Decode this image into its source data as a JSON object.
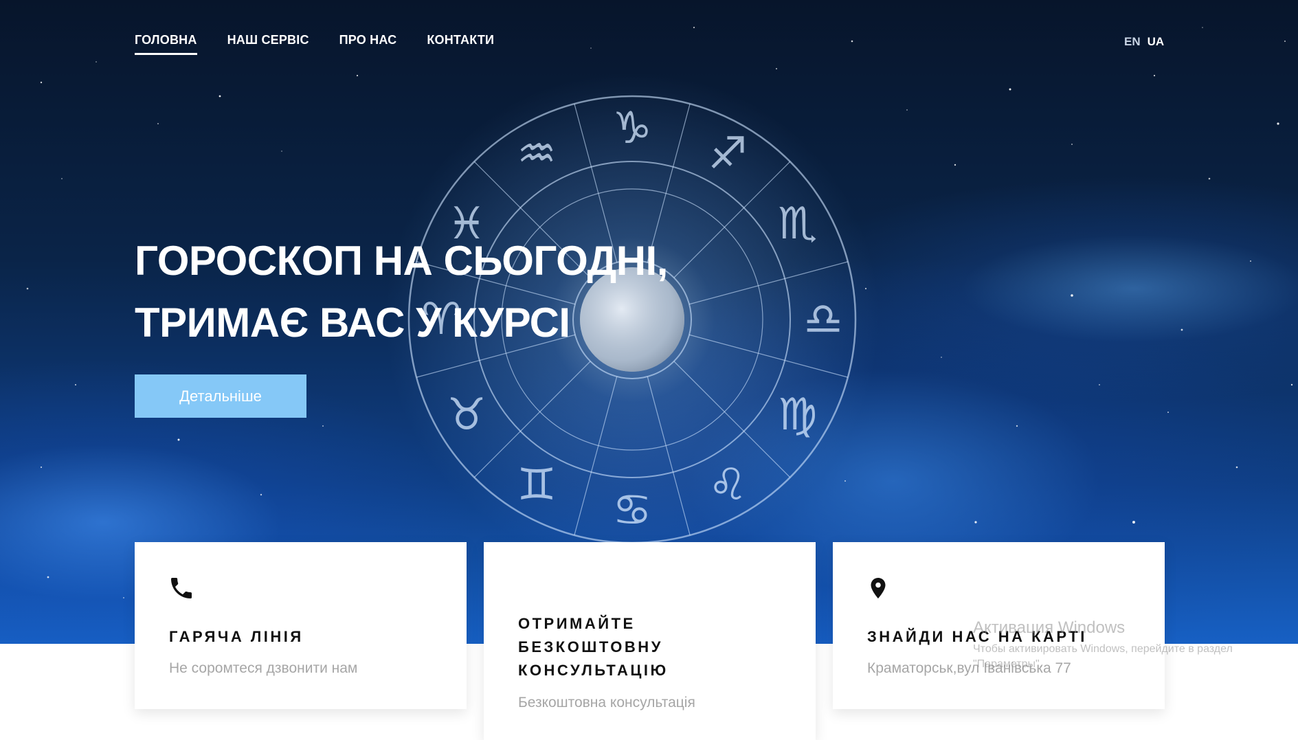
{
  "nav": {
    "items": [
      {
        "label": "ГОЛОВНА",
        "active": true
      },
      {
        "label": "НАШ СЕРВІС",
        "active": false
      },
      {
        "label": "ПРО НАС",
        "active": false
      },
      {
        "label": "КОНТАКТИ",
        "active": false
      }
    ]
  },
  "lang": {
    "en": "EN",
    "ua": "UA",
    "selected": "UA"
  },
  "hero": {
    "title_line1": "ГОРОСКОП НА СЬОГОДНІ,",
    "title_line2": "ТРИМАЄ ВАС У КУРСІ",
    "cta_label": "Детальніше",
    "background_image": "zodiac-wheel-with-full-moon-on-starry-sky",
    "zodiac_symbols": [
      "♑",
      "♐",
      "♏",
      "♎",
      "♍",
      "♌",
      "♋",
      "♊",
      "♉",
      "♈",
      "♓",
      "♒"
    ]
  },
  "cards": [
    {
      "icon": "phone-icon",
      "title_lines": [
        "ГАРЯЧА ЛІНІЯ"
      ],
      "text": "Не соромтеся дзвонити нам"
    },
    {
      "icon": null,
      "title_lines": [
        "ОТРИМАЙТЕ",
        "БЕЗКОШТОВНУ",
        "КОНСУЛЬТАЦІЮ"
      ],
      "text": "Безкоштовна консультація"
    },
    {
      "icon": "map-pin-icon",
      "title_lines": [
        "ЗНАЙДИ НАС НА КАРТІ"
      ],
      "text": "Краматорськ,вул Іванівська 77"
    }
  ],
  "watermark": {
    "title": "Активация Windows",
    "text": "Чтобы активировать Windows, перейдите в раздел \"Параметры\"."
  },
  "colors": {
    "cta": "#85c8f7",
    "nav_text": "#ffffff",
    "card_title": "#111111",
    "card_text": "#a6a6a6"
  }
}
